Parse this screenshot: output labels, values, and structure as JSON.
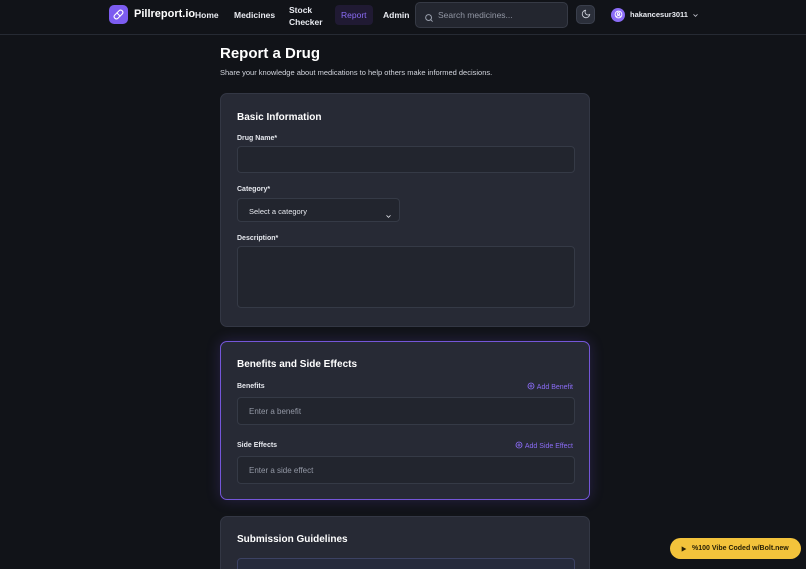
{
  "header": {
    "brand": "Pillreport.io",
    "nav": {
      "home": "Home",
      "medicines": "Medicines",
      "stock_checker": "Stock Checker",
      "report": "Report",
      "admin": "Admin"
    },
    "search": {
      "placeholder": "Search medicines..."
    },
    "user": {
      "name": "hakancesur3011"
    },
    "icons": {
      "logo": "pill-icon",
      "search": "search-icon",
      "theme": "moon-icon",
      "avatar": "user-icon",
      "menu": "chevron-down-icon"
    }
  },
  "page": {
    "title": "Report a Drug",
    "subtitle": "Share your knowledge about medications to help others make informed decisions."
  },
  "basic_info": {
    "title": "Basic Information",
    "drug_name_label": "Drug Name*",
    "drug_name_value": "",
    "category_label": "Category*",
    "category_value": "Select a category",
    "description_label": "Description*",
    "description_value": ""
  },
  "effects": {
    "title": "Benefits and Side Effects",
    "benefits_label": "Benefits",
    "add_benefit": "Add Benefit",
    "benefit_placeholder": "Enter a benefit",
    "side_effects_label": "Side Effects",
    "add_side_effect": "Add Side Effect",
    "side_effect_placeholder": "Enter a side effect"
  },
  "guidelines": {
    "title": "Submission Guidelines"
  },
  "badge": {
    "text": "%100 Vibe Coded w/Bolt.new"
  },
  "colors": {
    "background": "#111318",
    "card": "#272a35",
    "accent": "#8b6cf6",
    "badge": "#f3c33b"
  }
}
